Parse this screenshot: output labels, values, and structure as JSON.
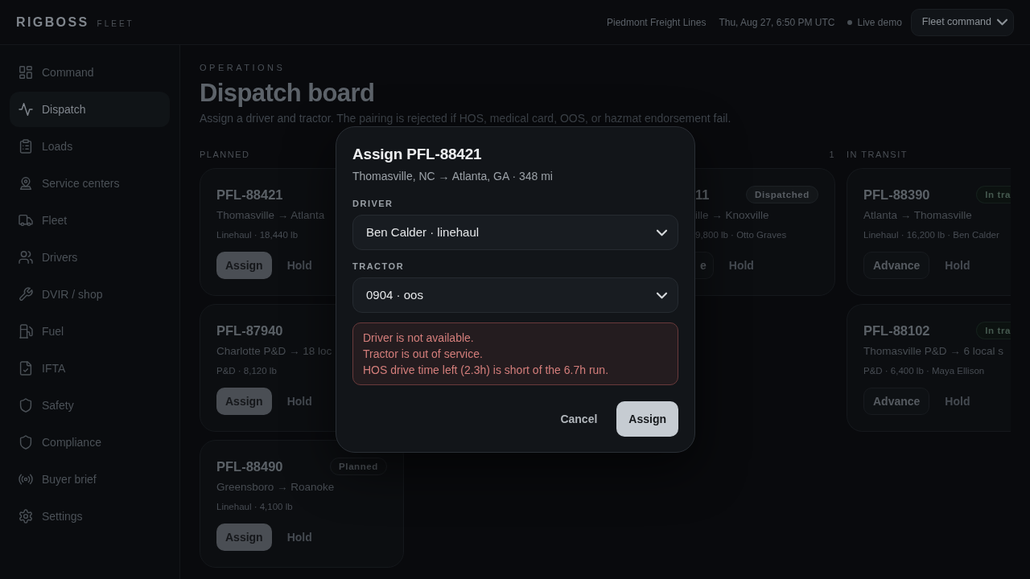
{
  "topbar": {
    "brand": "RIGBOSS",
    "brand_sub": "FLEET",
    "company": "Piedmont Freight Lines",
    "datetime": "Thu, Aug 27, 6:50 PM UTC",
    "live_label": "Live demo",
    "view_select": "Fleet command"
  },
  "sidebar": {
    "items": [
      {
        "label": "Command",
        "selected": false
      },
      {
        "label": "Dispatch",
        "selected": true
      },
      {
        "label": "Loads",
        "selected": false
      },
      {
        "label": "Service centers",
        "selected": false
      },
      {
        "label": "Fleet",
        "selected": false
      },
      {
        "label": "Drivers",
        "selected": false
      },
      {
        "label": "DVIR / shop",
        "selected": false
      },
      {
        "label": "Fuel",
        "selected": false
      },
      {
        "label": "IFTA",
        "selected": false
      },
      {
        "label": "Safety",
        "selected": false
      },
      {
        "label": "Compliance",
        "selected": false
      },
      {
        "label": "Buyer brief",
        "selected": false
      },
      {
        "label": "Settings",
        "selected": false
      }
    ]
  },
  "page": {
    "eyebrow": "OPERATIONS",
    "title": "Dispatch board",
    "subtitle": "Assign a driver and tractor. The pairing is rejected if HOS, medical card, OOS, or hazmat endorsement fail."
  },
  "board": {
    "columns": [
      {
        "title": "PLANNED",
        "cards": [
          {
            "id": "PFL-88421",
            "route": "Thomasville → Atlanta",
            "details": "Linehaul · 18,440 lb",
            "actions": [
              {
                "label": "Assign",
                "kind": "filled"
              },
              {
                "label": "Hold",
                "kind": "plain"
              }
            ]
          },
          {
            "id": "PFL-87940",
            "route": "Charlotte P&D → 18 loc",
            "details": "P&D · 8,120 lb",
            "actions": [
              {
                "label": "Assign",
                "kind": "filled"
              },
              {
                "label": "Hold",
                "kind": "plain"
              }
            ]
          },
          {
            "id": "PFL-88490",
            "badge": {
              "label": "Planned",
              "kind": "planned"
            },
            "route": "Greensboro → Roanoke",
            "details": "Linehaul · 4,100 lb",
            "actions": [
              {
                "label": "Assign",
                "kind": "filled"
              },
              {
                "label": "Hold",
                "kind": "plain"
              }
            ]
          }
        ]
      },
      {
        "count": "1",
        "cards": [
          {
            "id": "11",
            "badge": {
              "label": "Dispatched",
              "kind": "dispatched"
            },
            "route": "ille → Knoxville",
            "details": "9,800 lb · Otto Graves",
            "actions": [
              {
                "label": "e",
                "kind": "outlined"
              },
              {
                "label": "Hold",
                "kind": "plain"
              }
            ]
          }
        ]
      },
      {
        "title": "IN TRANSIT",
        "cards": [
          {
            "id": "PFL-88390",
            "badge": {
              "label": "In tra",
              "kind": "in_transit"
            },
            "route": "Atlanta → Thomasville",
            "details": "Linehaul · 16,200 lb · Ben Calder",
            "actions": [
              {
                "label": "Advance",
                "kind": "outlined"
              },
              {
                "label": "Hold",
                "kind": "plain"
              }
            ]
          },
          {
            "id": "PFL-88102",
            "badge": {
              "label": "In tra",
              "kind": "in_transit"
            },
            "route": "Thomasville P&D → 6 local s",
            "details": "P&D · 6,400 lb · Maya Ellison",
            "actions": [
              {
                "label": "Advance",
                "kind": "outlined"
              },
              {
                "label": "Hold",
                "kind": "plain"
              }
            ]
          }
        ]
      }
    ]
  },
  "dialog": {
    "title": "Assign PFL-88421",
    "summary": "Thomasville, NC → Atlanta, GA · 348 mi",
    "fields": [
      {
        "label": "DRIVER",
        "value": "Ben Calder · linehaul"
      },
      {
        "label": "TRACTOR",
        "value": "0904 · oos"
      }
    ],
    "errors": [
      "Driver is not available.",
      "Tractor is out of service.",
      "HOS drive time left (2.3h) is short of the 6.7h run."
    ],
    "buttons": [
      {
        "label": "Cancel",
        "kind": "plain"
      },
      {
        "label": "Assign",
        "kind": "filled"
      }
    ]
  }
}
